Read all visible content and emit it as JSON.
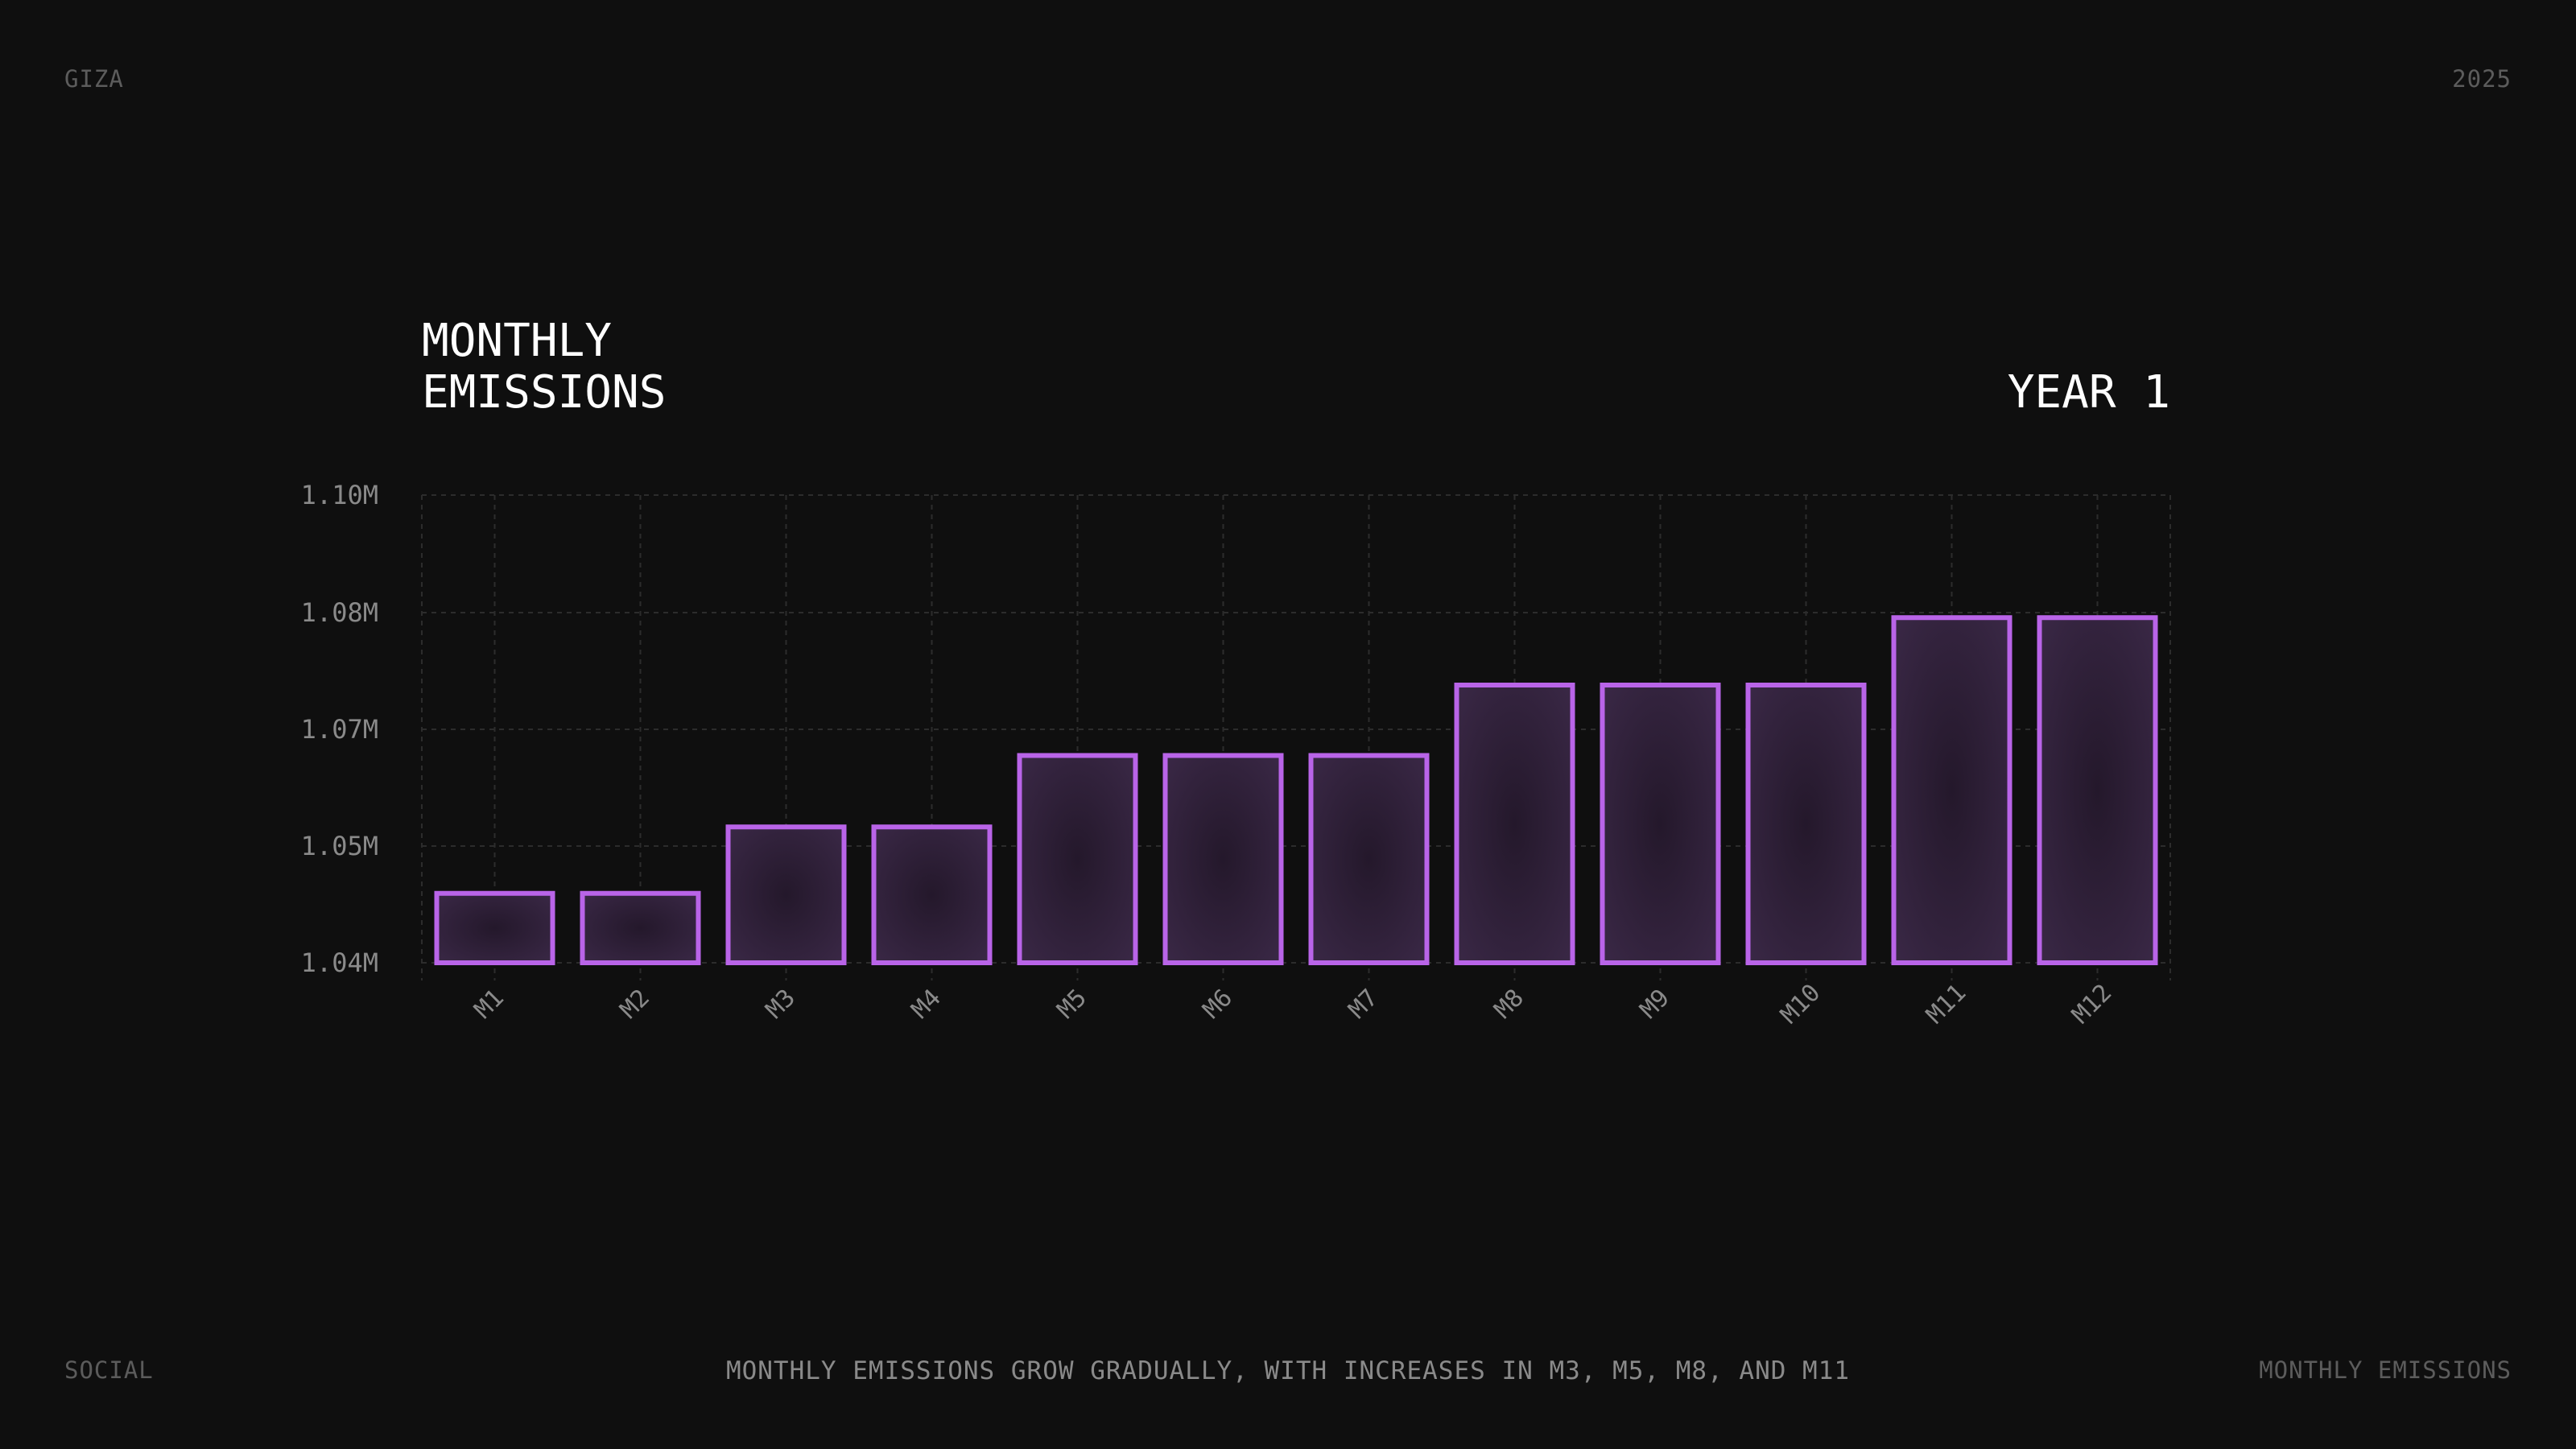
{
  "header": {
    "brand": "GIZA",
    "year": "2025"
  },
  "footer": {
    "left": "SOCIAL",
    "caption": "MONTHLY EMISSIONS GROW GRADUALLY, WITH INCREASES IN M3, M5, M8, AND M11",
    "right": "MONTHLY EMISSIONS"
  },
  "chart_data": {
    "type": "bar",
    "title": "MONTHLY\nEMISSIONS",
    "subtitle": "YEAR 1",
    "categories": [
      "M1",
      "M2",
      "M3",
      "M4",
      "M5",
      "M6",
      "M7",
      "M8",
      "M9",
      "M10",
      "M11",
      "M12"
    ],
    "values": [
      1.0469,
      1.0469,
      1.0535,
      1.0535,
      1.0606,
      1.0606,
      1.0606,
      1.0676,
      1.0676,
      1.0676,
      1.0743,
      1.0743
    ],
    "value_unit": "M",
    "y_ticks": [
      "1.04M",
      "1.05M",
      "1.07M",
      "1.08M",
      "1.10M"
    ],
    "ylim": [
      1.04,
      1.08
    ],
    "grid": true,
    "bar_stroke": "#b964e8",
    "bar_fill": "#2c1f34",
    "grid_color": "#2c2c2c",
    "tick_color": "#8a8a8a"
  }
}
